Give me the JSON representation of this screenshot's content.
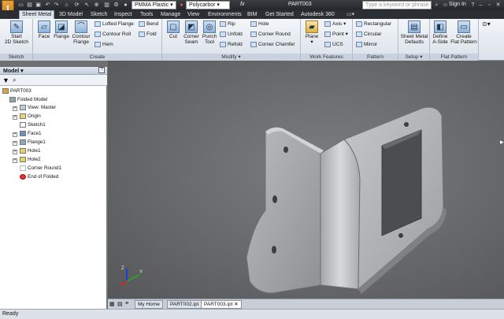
{
  "titlebar": {
    "app_logo": "I",
    "material": "PMMA Plastic",
    "appearance": "Polycarbor",
    "fx_label": "fx",
    "doc_title": "PART003",
    "search_placeholder": "Type a keyword or phrase",
    "sign_in": "Sign In",
    "help": "?"
  },
  "tabs": [
    "Sheet Metal",
    "3D Model",
    "Sketch",
    "Inspect",
    "Tools",
    "Manage",
    "View",
    "Environments",
    "BIM",
    "Get Started",
    "Autodesk 360"
  ],
  "ribbon": {
    "sketch_panel": {
      "title": "Sketch",
      "start_sketch": "Start",
      "start_sketch2": "2D Sketch"
    },
    "create_panel": {
      "title": "Create",
      "face": "Face",
      "flange": "Flange",
      "contour": "Contour",
      "contour2": "Flange",
      "lofted": "Lofted Flange",
      "contour_roll": "Contour Roll",
      "hem": "Hem",
      "bend": "Bend",
      "fold": "Fold"
    },
    "modify_panel": {
      "title": "Modify",
      "cut": "Cut",
      "corner": "Corner",
      "corner2": "Seam",
      "punch": "Punch",
      "punch2": "Tool",
      "rip": "Rip",
      "unfold": "Unfold",
      "refold": "Refold",
      "hole": "Hole",
      "corner_round": "Corner Round",
      "corner_chamfer": "Corner Chamfer"
    },
    "work_panel": {
      "title": "Work Features",
      "plane": "Plane",
      "axis": "Axis",
      "point": "Point",
      "ucs": "UCS"
    },
    "pattern_panel": {
      "title": "Pattern",
      "rectangular": "Rectangular",
      "circular": "Circular",
      "mirror": "Mirror"
    },
    "setup_panel": {
      "title": "Setup",
      "defaults": "Sheet Metal",
      "defaults2": "Defaults"
    },
    "flat_panel": {
      "title": "Flat Pattern",
      "define": "Define",
      "define2": "A-Side",
      "create": "Create",
      "create2": "Flat Pattern"
    }
  },
  "browser": {
    "title": "Model",
    "help": "?",
    "root": "PART003",
    "items": [
      {
        "label": "Folded Model"
      },
      {
        "label": "View: Master"
      },
      {
        "label": "Origin"
      },
      {
        "label": "Sketch1"
      },
      {
        "label": "Face1"
      },
      {
        "label": "Flange1"
      },
      {
        "label": "Hole1"
      },
      {
        "label": "Hole2"
      },
      {
        "label": "Corner Round1"
      },
      {
        "label": "End of Folded"
      }
    ]
  },
  "doc_tabs": [
    "My Home",
    "PART002.ipt",
    "PART003.ipt"
  ],
  "status": "Ready",
  "colors": {
    "ribbon_bg": "#e6ebf1",
    "viewport_bg": "#6a6b6c",
    "part": "#a9abad"
  }
}
